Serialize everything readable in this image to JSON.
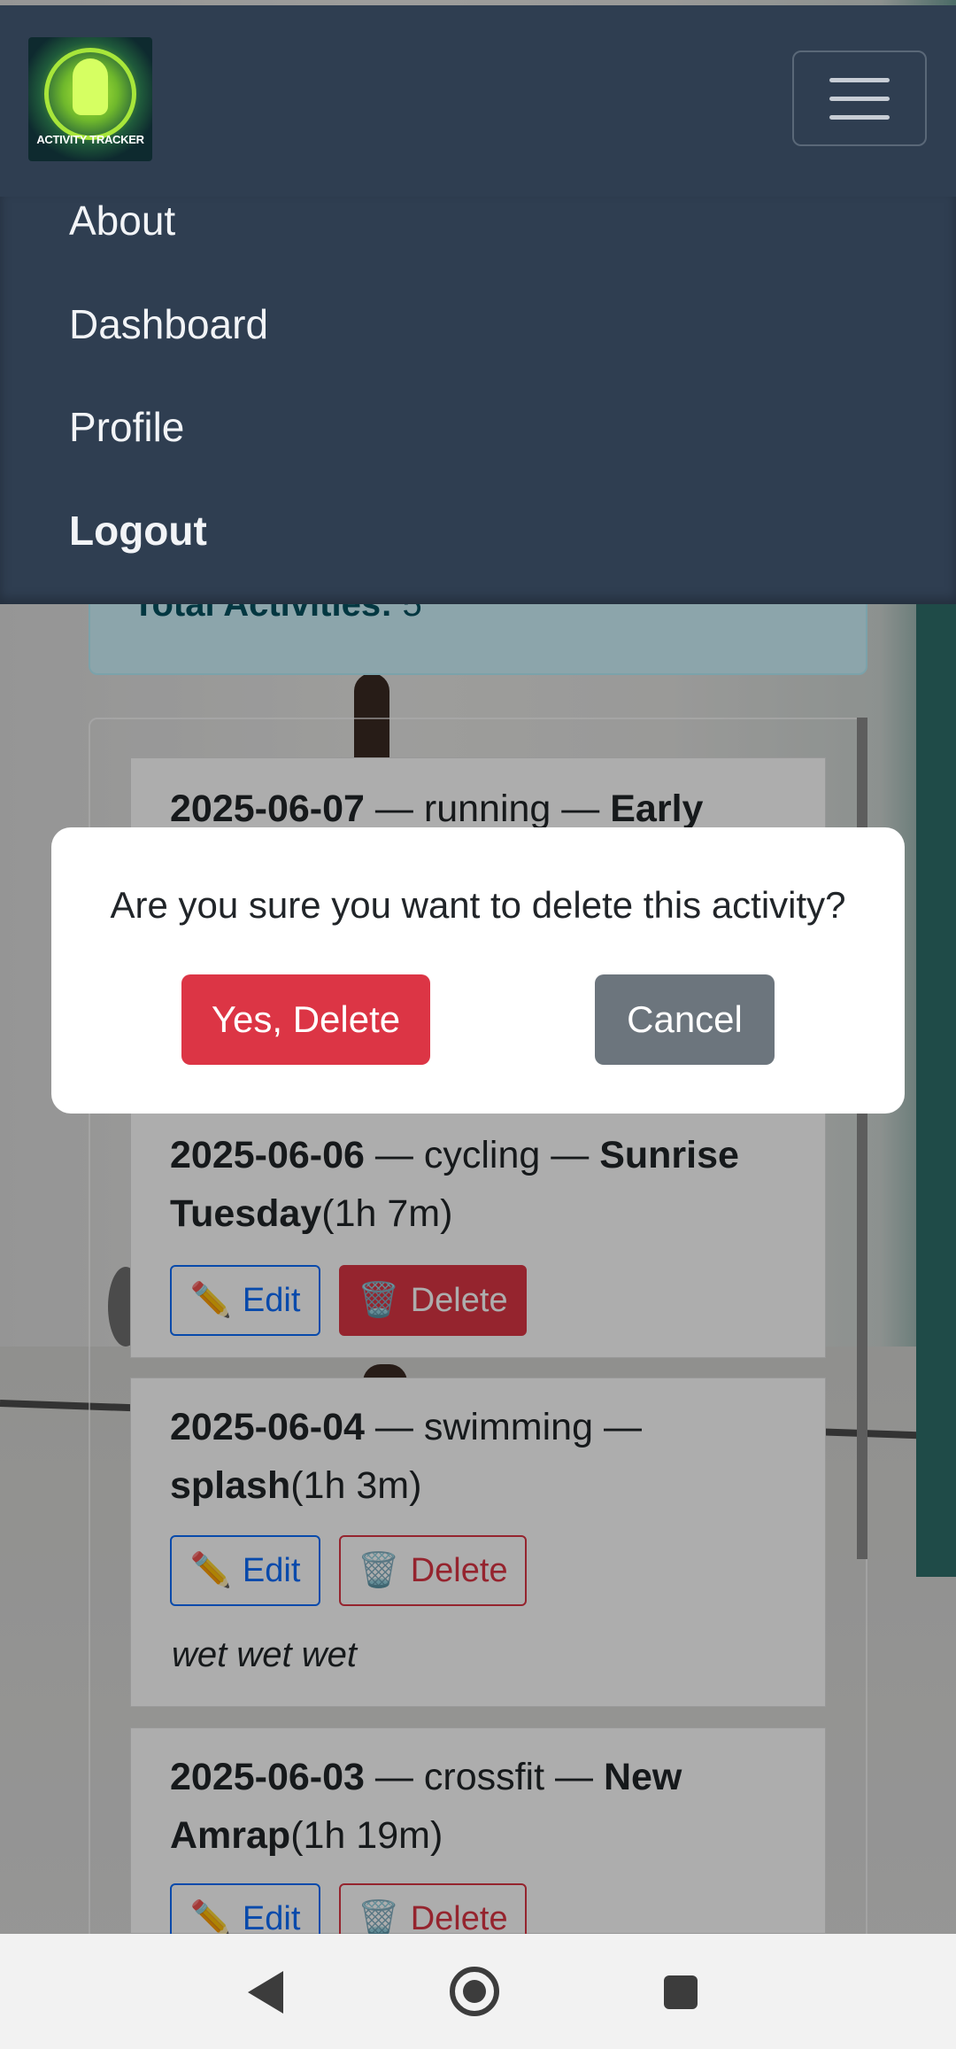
{
  "app": {
    "logo_text": "ACTIVITY TRACKER"
  },
  "menu": {
    "items": [
      {
        "label": "About"
      },
      {
        "label": "Dashboard"
      },
      {
        "label": "Profile"
      },
      {
        "label": "Logout"
      }
    ]
  },
  "summary": {
    "label": "Total Activities:",
    "value": "5"
  },
  "activities": [
    {
      "date": "2025-06-07",
      "sep1": " — ",
      "type": "running",
      "sep2": " — ",
      "name": "Early",
      "duration": "",
      "notes": ""
    },
    {
      "date": "2025-06-06",
      "sep1": " — ",
      "type": "cycling",
      "sep2": " — ",
      "name_line1": "Sunrise",
      "name_line2": "Tuesday",
      "duration": "(1h 7m)",
      "notes": ""
    },
    {
      "date": "2025-06-04",
      "sep1": " — ",
      "type": "swimming",
      "sep2": " —",
      "name": "splash",
      "duration": "(1h 3m)",
      "notes": "wet wet wet"
    },
    {
      "date": "2025-06-03",
      "sep1": " — ",
      "type": "crossfit",
      "sep2": " — ",
      "name_line1": "New",
      "name_line2": "Amrap",
      "duration": "(1h 19m)",
      "notes": ""
    }
  ],
  "buttons": {
    "edit_label": "Edit",
    "delete_label": "Delete",
    "edit_icon": "pencil-icon",
    "delete_icon": "trash-icon"
  },
  "modal": {
    "message": "Are you sure you want to delete this activity?",
    "confirm_label": "Yes, Delete",
    "cancel_label": "Cancel"
  },
  "colors": {
    "navbar": "#2f3e51",
    "danger": "#dc3545",
    "secondary": "#6c757d",
    "primary": "#0d6efd"
  }
}
